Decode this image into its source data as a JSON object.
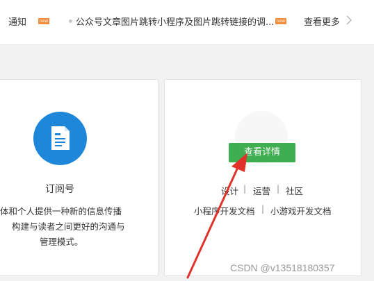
{
  "announcements": {
    "items": [
      {
        "text": "通知",
        "badge": "new"
      },
      {
        "text": "公众号文章图片跳转小程序及图片跳转链接的调...",
        "badge": "new"
      }
    ],
    "see_more": "查看更多"
  },
  "cards": {
    "subscription": {
      "title": "订阅号",
      "description_lines": [
        "体和个人提供一种新的信息传播",
        "构建与读者之间更好的沟通与",
        "管理模式。"
      ]
    },
    "mini_program": {
      "button": "查看详情",
      "links": [
        "设计",
        "运营",
        "社区"
      ],
      "docs": [
        "小程序开发文档",
        "小游戏开发文档"
      ]
    }
  },
  "watermark": "CSDN @v13518180357",
  "colors": {
    "accent_blue": "#1e87d9",
    "button_green": "#3fae51",
    "badge_orange": "#f08c3c",
    "arrow_red": "#e0322b"
  }
}
